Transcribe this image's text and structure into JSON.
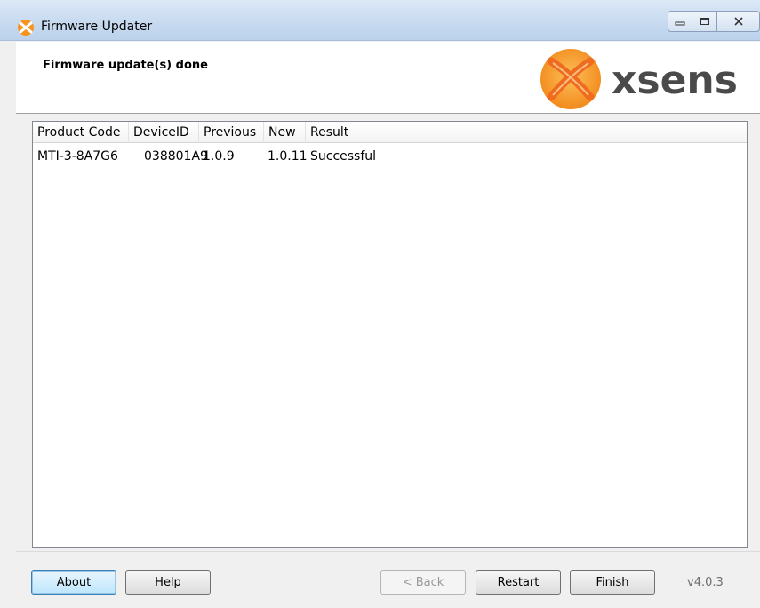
{
  "window": {
    "title": "Firmware Updater"
  },
  "header": {
    "title": "Firmware update(s) done",
    "logo_text": "xsens",
    "logo_color": "#f7931e"
  },
  "table": {
    "columns": [
      "Product Code",
      "DeviceID",
      "Previous",
      "New",
      "Result"
    ],
    "rows": [
      [
        "MTI-3-8A7G6",
        "038801A9",
        "1.0.9",
        "1.0.11",
        "Successful"
      ]
    ]
  },
  "footer": {
    "about_label": "About",
    "help_label": "Help",
    "back_label": "< Back",
    "restart_label": "Restart",
    "finish_label": "Finish",
    "version": "v4.0.3"
  },
  "icons": {
    "app": "xsens-logo-icon",
    "minimize": "minimize-icon",
    "maximize": "maximize-icon",
    "close": "close-icon"
  }
}
